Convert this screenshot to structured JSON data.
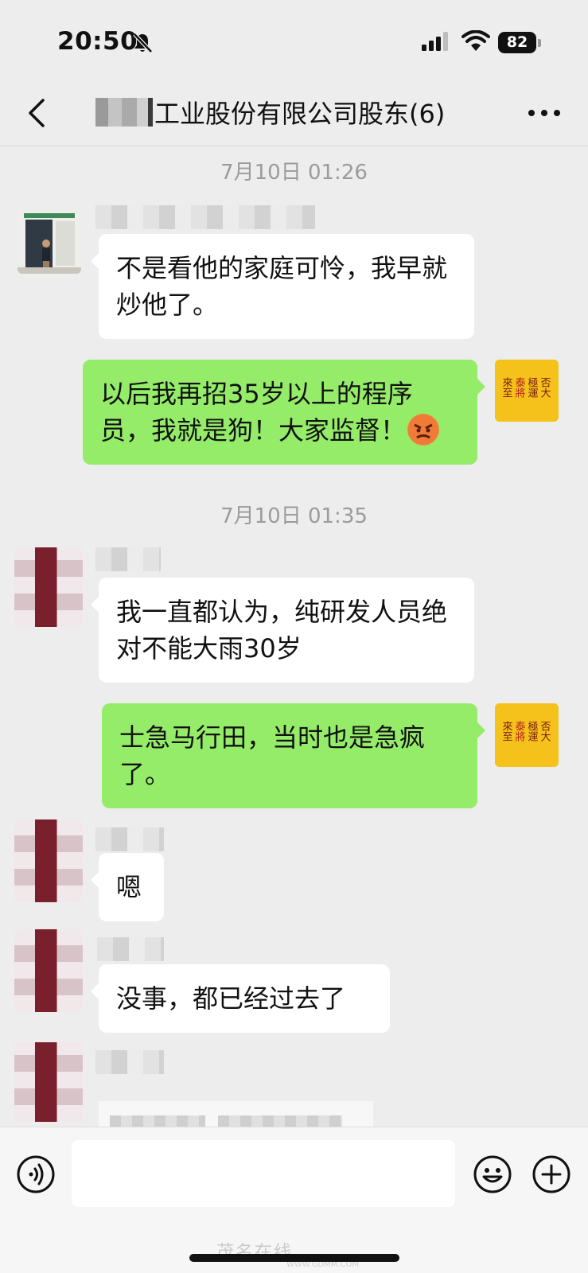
{
  "status_bar": {
    "time": "20:50",
    "battery": "82"
  },
  "nav": {
    "title": "工业股份有限公司股东(6)"
  },
  "messages": {
    "ts1": "7月10日 01:26",
    "m1": "不是看他的家庭可怜，我早就炒他了。",
    "m2": "以后我再招35岁以上的程序员，我就是狗！大家监督！",
    "ts2": "7月10日 01:35",
    "m3": "我一直都认为，纯研发人员绝对不能大雨30岁",
    "m4": "士急马行田，当时也是急疯了。",
    "m5": "嗯",
    "m6": "没事，都已经过去了"
  },
  "avatar_seal": {
    "col1": "否大",
    "col2": "極運",
    "col3": "泰將",
    "col4": "來至"
  },
  "watermark": {
    "text": "茂名在线",
    "url": "WWW.GDMM.COM"
  },
  "colors": {
    "green_bubble": "#95ec69",
    "background": "#ededed",
    "white_bubble": "#ffffff"
  },
  "icons": [
    "bell-slash-icon",
    "signal-icon",
    "wifi-icon",
    "battery-icon",
    "back-chevron-icon",
    "more-icon",
    "angry-emoji-icon",
    "voice-icon",
    "emoji-face-icon",
    "plus-icon"
  ]
}
